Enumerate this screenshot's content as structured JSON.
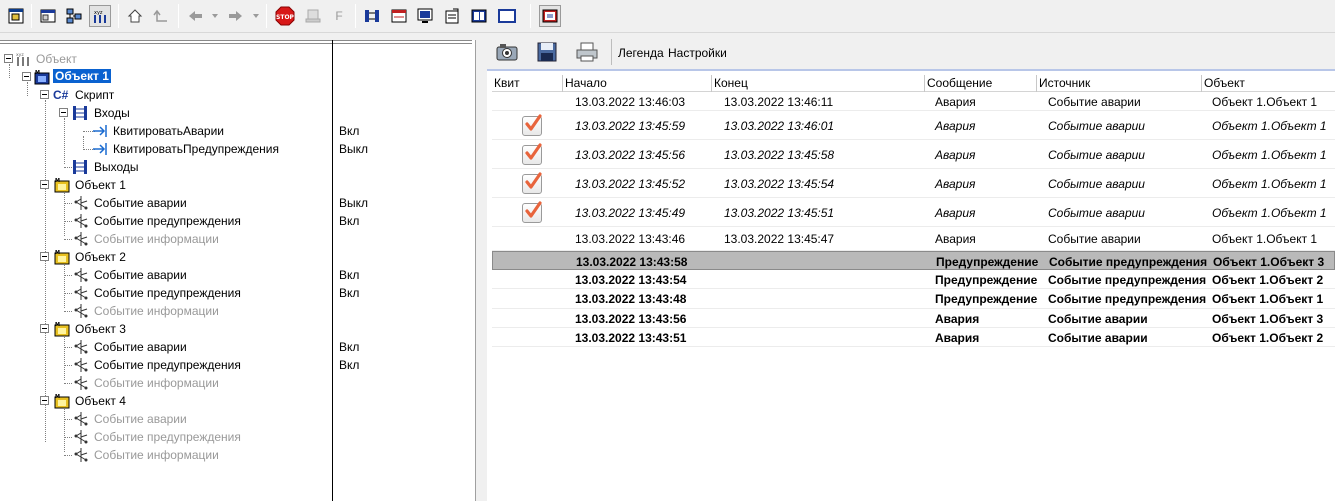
{
  "toolbar": {
    "buttons": [
      {
        "icon": "window-icon"
      },
      {
        "icon": "panels-icon"
      },
      {
        "icon": "network-icon"
      },
      {
        "icon": "object-tree-icon"
      },
      {
        "icon": "home-icon"
      },
      {
        "icon": "up-level-icon"
      },
      {
        "icon": "back-arrow-icon"
      },
      {
        "icon": "forward-arrow-icon"
      },
      {
        "icon": "stop-icon",
        "label": "STOP"
      },
      {
        "icon": "device-icon"
      },
      {
        "icon": "font-icon",
        "label": "F"
      },
      {
        "icon": "inputs-outputs-icon"
      },
      {
        "icon": "form-icon"
      },
      {
        "icon": "monitor-icon"
      },
      {
        "icon": "properties-icon"
      },
      {
        "icon": "book-icon"
      },
      {
        "icon": "frame-icon"
      },
      {
        "icon": "journal-icon"
      }
    ]
  },
  "tree": {
    "root": "Объект",
    "nodes": [
      {
        "label": "Объект 1",
        "value": ""
      },
      {
        "label": "Скрипт",
        "prefix": "C#",
        "value": ""
      },
      {
        "label": "Входы",
        "value": ""
      },
      {
        "label": "КвитироватьАварии",
        "value": "Вкл"
      },
      {
        "label": "КвитироватьПредупреждения",
        "value": "Выкл"
      },
      {
        "label": "Выходы",
        "value": ""
      },
      {
        "label": "Объект 1",
        "value": ""
      },
      {
        "label": "Событие аварии",
        "value": "Выкл"
      },
      {
        "label": "Событие предупреждения",
        "value": "Вкл"
      },
      {
        "label": "Событие информации",
        "value": ""
      },
      {
        "label": "Объект 2",
        "value": ""
      },
      {
        "label": "Событие аварии",
        "value": "Вкл"
      },
      {
        "label": "Событие предупреждения",
        "value": "Вкл"
      },
      {
        "label": "Событие информации",
        "value": ""
      },
      {
        "label": "Объект 3",
        "value": ""
      },
      {
        "label": "Событие аварии",
        "value": "Вкл"
      },
      {
        "label": "Событие предупреждения",
        "value": "Вкл"
      },
      {
        "label": "Событие информации",
        "value": ""
      },
      {
        "label": "Объект 4",
        "value": ""
      },
      {
        "label": "Событие аварии",
        "value": ""
      },
      {
        "label": "Событие предупреждения",
        "value": ""
      },
      {
        "label": "Событие информации",
        "value": ""
      }
    ]
  },
  "events_panel": {
    "toolbar": {
      "camera_icon": "camera-icon",
      "save_icon": "save-icon",
      "print_icon": "printer-icon",
      "legend_label": "Легенда",
      "settings_label": "Настройки"
    },
    "columns": [
      "Квит",
      "Начало",
      "Конец",
      "Сообщение",
      "Источник",
      "Объект"
    ],
    "rows": [
      {
        "ack": false,
        "start": "13.03.2022 13:46:03",
        "end": "13.03.2022 13:46:11",
        "message": "Авария",
        "source": "Событие аварии",
        "object": "Объект 1.Объект 1",
        "style": "normal"
      },
      {
        "ack": true,
        "start": "13.03.2022 13:45:59",
        "end": "13.03.2022 13:46:01",
        "message": "Авария",
        "source": "Событие аварии",
        "object": "Объект 1.Объект 1",
        "style": "italic"
      },
      {
        "ack": true,
        "start": "13.03.2022 13:45:56",
        "end": "13.03.2022 13:45:58",
        "message": "Авария",
        "source": "Событие аварии",
        "object": "Объект 1.Объект 1",
        "style": "italic"
      },
      {
        "ack": true,
        "start": "13.03.2022 13:45:52",
        "end": "13.03.2022 13:45:54",
        "message": "Авария",
        "source": "Событие аварии",
        "object": "Объект 1.Объект 1",
        "style": "italic"
      },
      {
        "ack": true,
        "start": "13.03.2022 13:45:49",
        "end": "13.03.2022 13:45:51",
        "message": "Авария",
        "source": "Событие аварии",
        "object": "Объект 1.Объект 1",
        "style": "italic"
      },
      {
        "ack": false,
        "start": "13.03.2022 13:43:46",
        "end": "13.03.2022 13:45:47",
        "message": "Авария",
        "source": "Событие аварии",
        "object": "Объект 1.Объект 1",
        "style": "normal"
      },
      {
        "ack": false,
        "start": "13.03.2022 13:43:58",
        "end": "",
        "message": "Предупреждение",
        "source": "Событие предупреждения",
        "object": "Объект 1.Объект 3",
        "style": "bold",
        "selected": true
      },
      {
        "ack": false,
        "start": "13.03.2022 13:43:54",
        "end": "",
        "message": "Предупреждение",
        "source": "Событие предупреждения",
        "object": "Объект 1.Объект 2",
        "style": "bold"
      },
      {
        "ack": false,
        "start": "13.03.2022 13:43:48",
        "end": "",
        "message": "Предупреждение",
        "source": "Событие предупреждения",
        "object": "Объект 1.Объект 1",
        "style": "bold"
      },
      {
        "ack": false,
        "start": "13.03.2022 13:43:56",
        "end": "",
        "message": "Авария",
        "source": "Событие аварии",
        "object": "Объект 1.Объект 3",
        "style": "bold"
      },
      {
        "ack": false,
        "start": "13.03.2022 13:43:51",
        "end": "",
        "message": "Авария",
        "source": "Событие аварии",
        "object": "Объект 1.Объект 2",
        "style": "bold"
      }
    ],
    "colors": {
      "selected_row": "#b9b9b9",
      "check": "#e8643c",
      "tree_selection": "#0a62d0"
    }
  }
}
